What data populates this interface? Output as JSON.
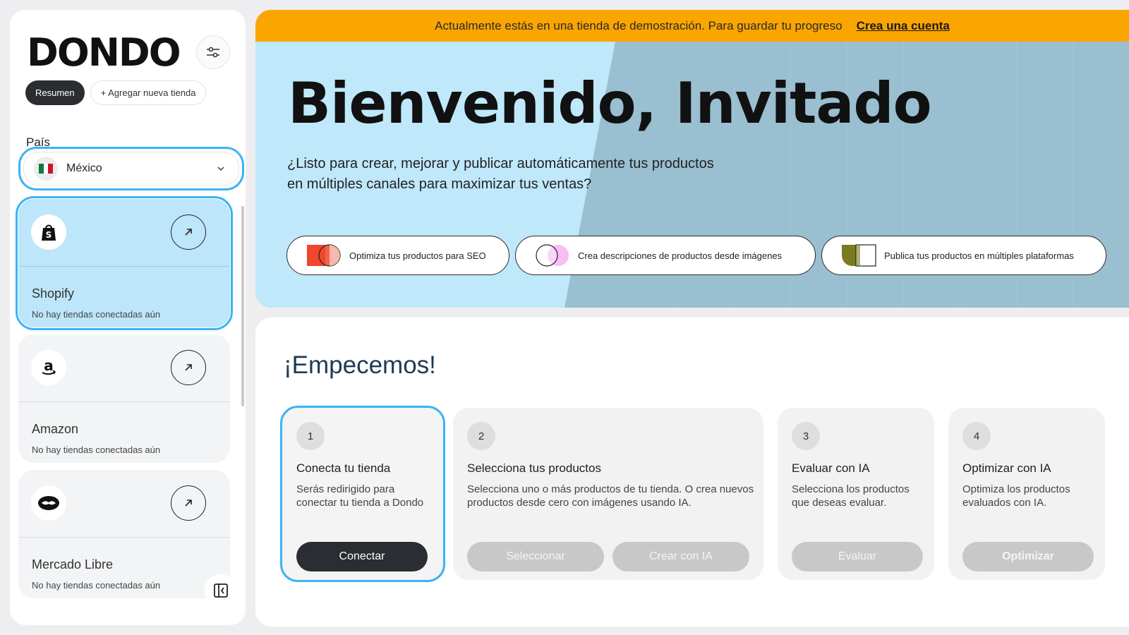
{
  "sidebar": {
    "logo": "DONDO",
    "summary_label": "Resumen",
    "add_store_label": "+ Agregar nueva tienda",
    "country_label": "País",
    "country_value": "México",
    "stores": [
      {
        "name": "Shopify",
        "status": "No hay tiendas conectadas aún",
        "icon": "shopify-bag-icon"
      },
      {
        "name": "Amazon",
        "status": "No hay tiendas conectadas aún",
        "icon": "amazon-logo-icon"
      },
      {
        "name": "Mercado Libre",
        "status": "No hay tiendas conectadas aún",
        "icon": "handshake-icon"
      }
    ]
  },
  "banner": {
    "text": "Actualmente estás en una tienda de demostración. Para guardar tu progreso",
    "link": "Crea una cuenta"
  },
  "hero": {
    "title": "Bienvenido, Invitado",
    "subtitle": "¿Listo para crear, mejorar y publicar automáticamente tus productos en múltiples canales para maximizar tus ventas?",
    "chips": [
      "Optimiza tus productos para SEO",
      "Crea descripciones de productos desde imágenes",
      "Publica tus productos en múltiples plataformas"
    ]
  },
  "start": {
    "title": "¡Empecemos!",
    "steps": [
      {
        "num": "1",
        "title": "Conecta tu tienda",
        "desc": "Serás redirigido para conectar tu tienda a Dondo",
        "buttons": [
          "Conectar"
        ]
      },
      {
        "num": "2",
        "title": "Selecciona tus productos",
        "desc": "Selecciona uno o más productos de tu tienda. O crea nuevos productos desde cero con imágenes usando IA.",
        "buttons": [
          "Seleccionar",
          "Crear con IA"
        ]
      },
      {
        "num": "3",
        "title": "Evaluar con IA",
        "desc": "Selecciona los productos que deseas evaluar.",
        "buttons": [
          "Evaluar"
        ]
      },
      {
        "num": "4",
        "title": "Optimizar con IA",
        "desc": "Optimiza los productos evaluados con IA.",
        "buttons": [
          "Optimizar"
        ]
      }
    ]
  },
  "colors": {
    "accent": "#3bb3f4",
    "banner": "#fba500",
    "hero_bg": "#bfe8fb",
    "dark_button": "#2a2d31"
  }
}
